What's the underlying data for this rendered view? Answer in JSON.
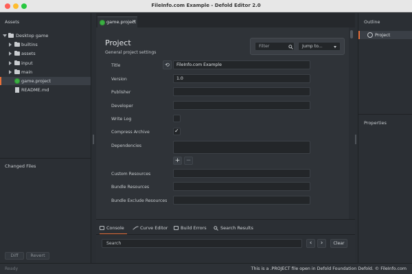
{
  "window": {
    "title": "FileInfo.com Example - Defold Editor 2.0"
  },
  "assets": {
    "header": "Assets",
    "tree": [
      {
        "label": "Desktop game",
        "kind": "folder",
        "expanded": true
      },
      {
        "label": "builtins",
        "kind": "folder",
        "expanded": false
      },
      {
        "label": "assets",
        "kind": "folder",
        "expanded": false
      },
      {
        "label": "input",
        "kind": "folder",
        "expanded": false
      },
      {
        "label": "main",
        "kind": "folder",
        "expanded": false
      },
      {
        "label": "game.project",
        "kind": "project",
        "selected": true
      },
      {
        "label": "README.md",
        "kind": "file"
      }
    ]
  },
  "changed_files": {
    "header": "Changed Files",
    "diff_label": "Diff",
    "revert_label": "Revert"
  },
  "editor": {
    "tab_label": "game.project",
    "close_glyph": "×",
    "heading": "Project",
    "subheading": "General project settings",
    "filter_placeholder": "Filter",
    "jump_label": "Jump to...",
    "fields": {
      "title": {
        "label": "Title",
        "value": "FileInfo.com Example"
      },
      "version": {
        "label": "Version",
        "value": "1.0"
      },
      "publisher": {
        "label": "Publisher",
        "value": ""
      },
      "developer": {
        "label": "Developer",
        "value": ""
      },
      "write_log": {
        "label": "Write Log",
        "checked": false
      },
      "compress_archive": {
        "label": "Compress Archive",
        "checked": true
      },
      "dependencies": {
        "label": "Dependencies"
      },
      "custom_resources": {
        "label": "Custom Resources",
        "value": ""
      },
      "bundle_resources": {
        "label": "Bundle Resources",
        "value": ""
      },
      "bundle_exclude_resources": {
        "label": "Bundle Exclude Resources",
        "value": ""
      }
    },
    "add_glyph": "+",
    "remove_glyph": "−",
    "check_glyph": "✓",
    "reset_glyph": "⟲"
  },
  "console": {
    "tabs": [
      "Console",
      "Curve Editor",
      "Build Errors",
      "Search Results"
    ],
    "active_tab": 0,
    "search_placeholder": "Search",
    "prev_glyph": "‹",
    "next_glyph": "›",
    "clear_label": "Clear"
  },
  "outline": {
    "header": "Outline",
    "item": "Project"
  },
  "properties": {
    "header": "Properties"
  },
  "status": {
    "left": "Ready",
    "right": "This is a .PROJECT file open in Defold Foundation Defold. © FileInfo.com"
  },
  "colors": {
    "accent": "#e8703a",
    "selection": "#3a3f46",
    "panel": "#2b2f34",
    "editor_bg": "#2f3338"
  }
}
